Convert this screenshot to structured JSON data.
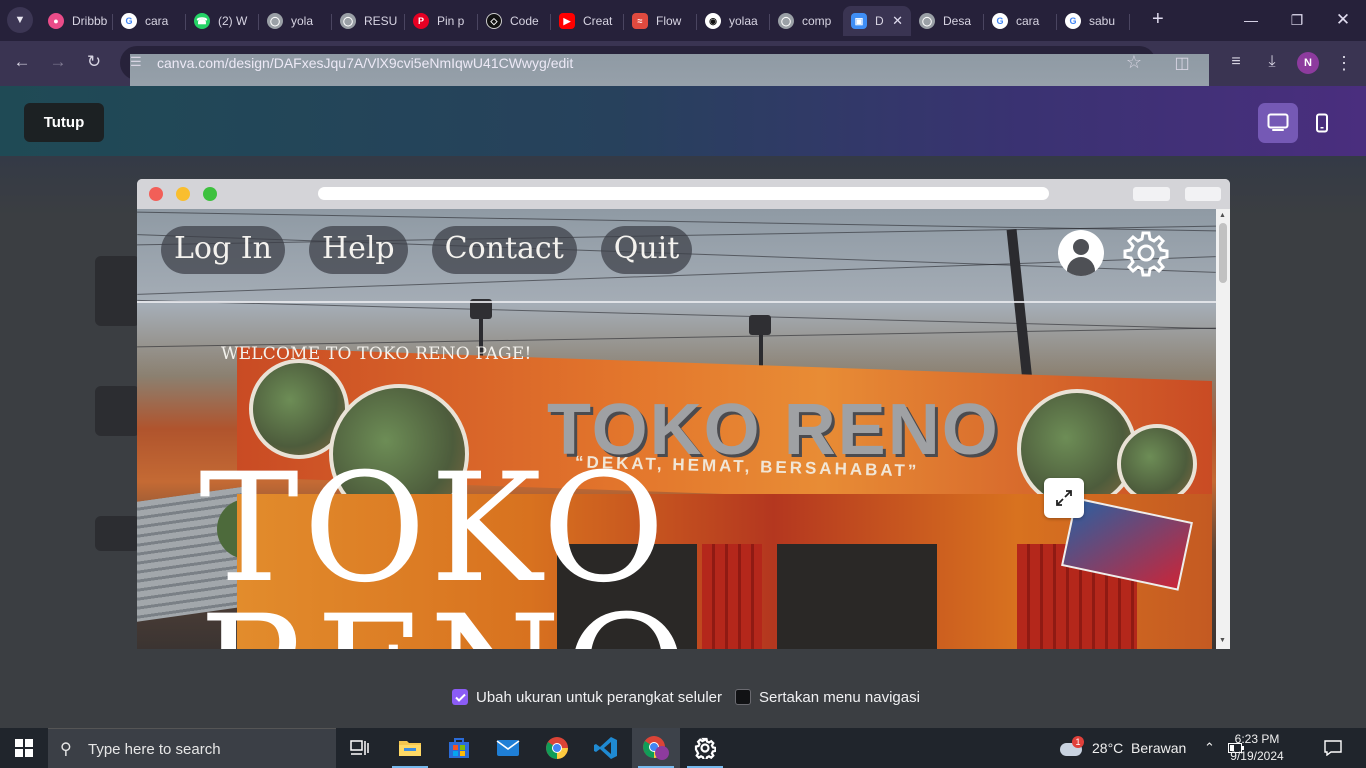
{
  "browser": {
    "tabs": [
      {
        "title": "Dribbble",
        "icon": "dribbble-icon",
        "color": "#ea4c89"
      },
      {
        "title": "cara",
        "icon": "google-icon",
        "color": "#ffffff"
      },
      {
        "title": "(2) W",
        "icon": "whatsapp-icon",
        "color": "#25d366"
      },
      {
        "title": "yola",
        "icon": "globe-icon",
        "color": "#9aa0a6"
      },
      {
        "title": "RESU",
        "icon": "globe-icon",
        "color": "#9aa0a6"
      },
      {
        "title": "Pin p",
        "icon": "pinterest-icon",
        "color": "#e60023"
      },
      {
        "title": "Code",
        "icon": "codepen-icon",
        "color": "#111111"
      },
      {
        "title": "Creat",
        "icon": "youtube-icon",
        "color": "#ff0000"
      },
      {
        "title": "Flow",
        "icon": "flow-icon",
        "color": "#e04a3f"
      },
      {
        "title": "yolaa",
        "icon": "github-icon",
        "color": "#ffffff"
      },
      {
        "title": "comp",
        "icon": "globe-icon",
        "color": "#9aa0a6"
      },
      {
        "title": "D",
        "icon": "canva-icon",
        "color": "#3f8ef5",
        "active": true
      },
      {
        "title": "Desa",
        "icon": "globe-icon",
        "color": "#9aa0a6"
      },
      {
        "title": "cara",
        "icon": "google-icon",
        "color": "#ffffff"
      },
      {
        "title": "sabu",
        "icon": "google-icon",
        "color": "#ffffff"
      }
    ],
    "url": "canva.com/design/DAFxesJqu7A/VlX9cvi5eNmIqwU41CWwyg/edit",
    "profile_initial": "N"
  },
  "canva": {
    "close_label": "Tutup",
    "device_toggle": {
      "desktop": "desktop-icon",
      "mobile": "mobile-icon",
      "selected": "desktop"
    },
    "options": {
      "resize_mobile": {
        "label": "Ubah ukuran untuk perangkat seluler",
        "checked": true
      },
      "include_nav": {
        "label": "Sertakan menu navigasi",
        "checked": false
      }
    }
  },
  "site": {
    "nav": [
      "Log In",
      "Help",
      "Contact",
      "Quit"
    ],
    "welcome": "WELCOME TO TOKO RENO PAGE!",
    "title_line1": "TOKO",
    "title_line2": "RENO",
    "sign_text": "TOKO RENO",
    "sign_tagline": "“DEKAT, HEMAT, BERSAHABAT”"
  },
  "taskbar": {
    "search_placeholder": "Type here to search",
    "weather": "28°C  Berawan",
    "weather_badge": "1",
    "time": "6:23 PM",
    "date": "9/19/2024"
  },
  "colors": {
    "tabstrip": "#26213a",
    "toolbar": "#3a3452",
    "canva_accent": "#7559b5",
    "checkbox_on": "#8b5cf6"
  }
}
